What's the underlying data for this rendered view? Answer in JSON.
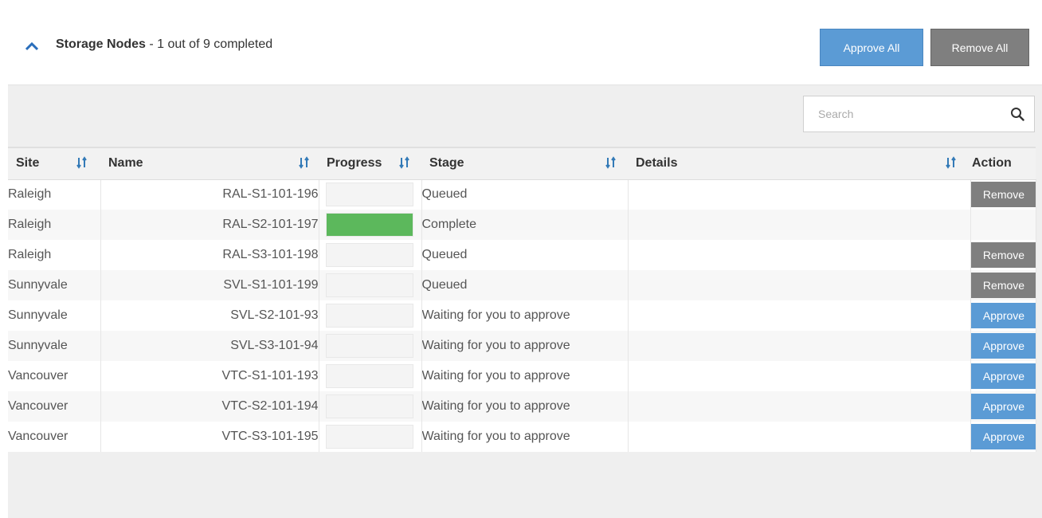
{
  "section": {
    "title": "Storage Nodes",
    "subtitle": " - 1 out of 9 completed",
    "approve_all_label": "Approve All",
    "remove_all_label": "Remove All"
  },
  "search": {
    "placeholder": "Search"
  },
  "columns": {
    "site": "Site",
    "name": "Name",
    "progress": "Progress",
    "stage": "Stage",
    "details": "Details",
    "action": "Action"
  },
  "colors": {
    "approve": "#5b9bd5",
    "remove": "#7f7f7f",
    "progress_complete": "#5cb85c",
    "sort_icon": "#337ab7"
  },
  "rows": [
    {
      "site": "Raleigh",
      "name": "RAL-S1-101-196",
      "progress": 0,
      "stage": "Queued",
      "details": "",
      "action": "Remove"
    },
    {
      "site": "Raleigh",
      "name": "RAL-S2-101-197",
      "progress": 1,
      "stage": "Complete",
      "details": "",
      "action": ""
    },
    {
      "site": "Raleigh",
      "name": "RAL-S3-101-198",
      "progress": 0,
      "stage": "Queued",
      "details": "",
      "action": "Remove"
    },
    {
      "site": "Sunnyvale",
      "name": "SVL-S1-101-199",
      "progress": 0,
      "stage": "Queued",
      "details": "",
      "action": "Remove"
    },
    {
      "site": "Sunnyvale",
      "name": "SVL-S2-101-93",
      "progress": 0,
      "stage": "Waiting for you to approve",
      "details": "",
      "action": "Approve"
    },
    {
      "site": "Sunnyvale",
      "name": "SVL-S3-101-94",
      "progress": 0,
      "stage": "Waiting for you to approve",
      "details": "",
      "action": "Approve"
    },
    {
      "site": "Vancouver",
      "name": "VTC-S1-101-193",
      "progress": 0,
      "stage": "Waiting for you to approve",
      "details": "",
      "action": "Approve"
    },
    {
      "site": "Vancouver",
      "name": "VTC-S2-101-194",
      "progress": 0,
      "stage": "Waiting for you to approve",
      "details": "",
      "action": "Approve"
    },
    {
      "site": "Vancouver",
      "name": "VTC-S3-101-195",
      "progress": 0,
      "stage": "Waiting for you to approve",
      "details": "",
      "action": "Approve"
    }
  ]
}
